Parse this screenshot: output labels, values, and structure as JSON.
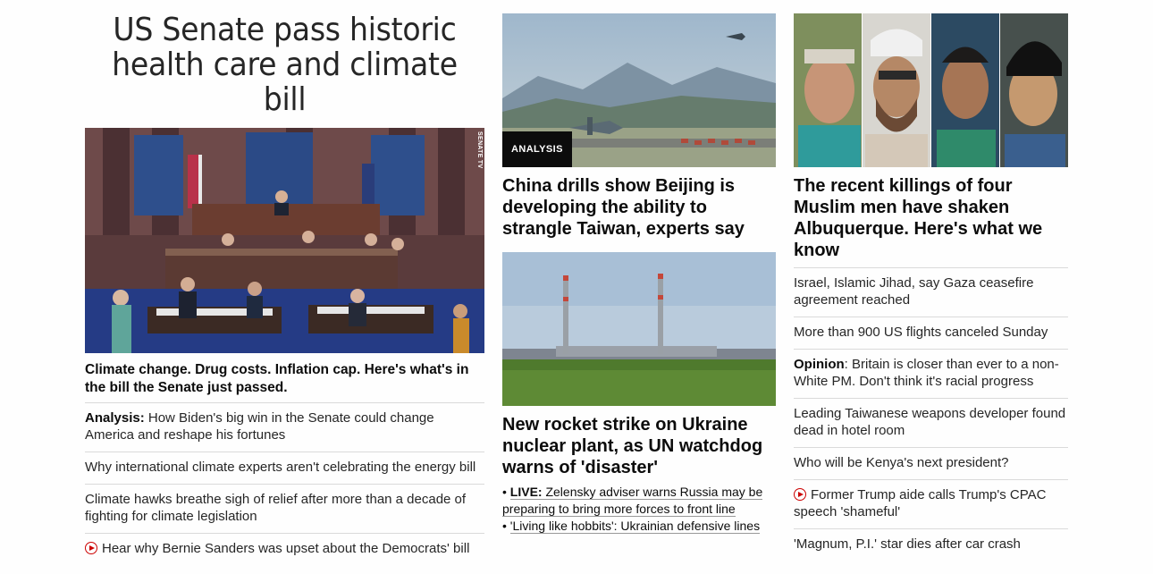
{
  "col1": {
    "headline": "US Senate pass historic health care and climate bill",
    "image_tag": "SENATE TV",
    "caption": "Climate change. Drug costs. Inflation cap. Here's what's in the bill the Senate just passed.",
    "links": [
      {
        "prefix": "Analysis:",
        "text": "How Biden's big win in the Senate could change America and reshape his fortunes",
        "video": false
      },
      {
        "prefix": "",
        "text": "Why international climate experts aren't celebrating the energy bill",
        "video": false
      },
      {
        "prefix": "",
        "text": "Climate hawks breathe sigh of relief after more than a decade of fighting for climate legislation",
        "video": false
      },
      {
        "prefix": "",
        "text": "Hear why Bernie Sanders was upset about the Democrats' bill",
        "video": true
      }
    ]
  },
  "col2": {
    "story1": {
      "badge": "ANALYSIS",
      "headline": "China drills show Beijing is developing the ability to strangle Taiwan, experts say"
    },
    "story2": {
      "headline": "New rocket strike on Ukraine nuclear plant, as UN watchdog warns of 'disaster'",
      "bullets": [
        {
          "live": "LIVE:",
          "text": "Zelensky adviser warns Russia may be preparing to bring more forces to front line"
        },
        {
          "live": "",
          "text": "'Living like hobbits': Ukrainian defensive lines"
        }
      ]
    }
  },
  "col3": {
    "headline": "The recent killings of four Muslim men have shaken Albuquerque. Here's what we know",
    "links": [
      {
        "prefix": "",
        "text": "Israel, Islamic Jihad, say Gaza ceasefire agreement reached",
        "video": false
      },
      {
        "prefix": "",
        "text": "More than 900 US flights canceled Sunday",
        "video": false
      },
      {
        "prefix": "Opinion",
        "text": ": Britain is closer than ever to a non-White PM. Don't think it's racial progress",
        "video": false
      },
      {
        "prefix": "",
        "text": "Leading Taiwanese weapons developer found dead in hotel room",
        "video": false
      },
      {
        "prefix": "",
        "text": "Who will be Kenya's next president?",
        "video": false
      },
      {
        "prefix": "",
        "text": "Former Trump aide calls Trump's CPAC speech 'shameful'",
        "video": true
      },
      {
        "prefix": "",
        "text": "'Magnum, P.I.' star dies after car crash",
        "video": false
      }
    ]
  },
  "colors": {
    "text": "#0c0c0c",
    "divider": "#dadada",
    "video_red": "#cc0000",
    "badge_bg": "#0c0c0c"
  }
}
